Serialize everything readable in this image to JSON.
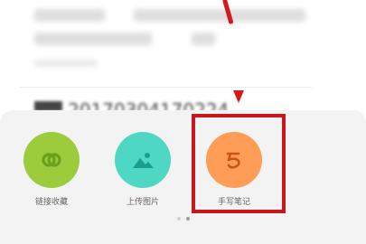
{
  "sheet": {
    "actions": [
      {
        "label": "链接收藏",
        "icon": "link-icon",
        "color": "#9ccc3c"
      },
      {
        "label": "上传图片",
        "icon": "image-icon",
        "color": "#4ed8c4"
      },
      {
        "label": "手写笔记",
        "icon": "handwriting-icon",
        "color": "#ff9d57"
      }
    ],
    "page_count": 2,
    "active_page": 2
  },
  "colors": {
    "highlight": "#c8161d",
    "arrow": "#d31919"
  }
}
